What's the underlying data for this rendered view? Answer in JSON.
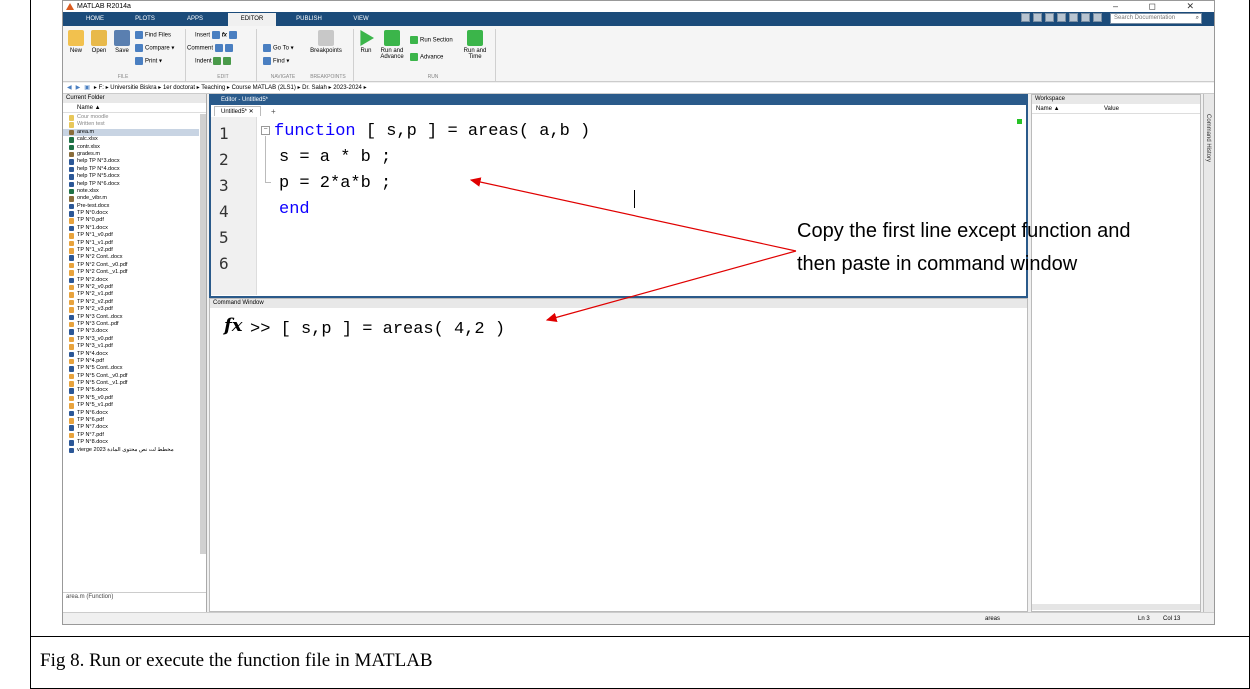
{
  "app": {
    "title": "MATLAB R2014a",
    "window_controls": "–  ◻  ✕"
  },
  "tabs": [
    "HOME",
    "PLOTS",
    "APPS",
    "EDITOR",
    "PUBLISH",
    "VIEW"
  ],
  "search_placeholder": "Search Documentation",
  "ribbon": {
    "file": {
      "new": "New",
      "open": "Open",
      "save": "Save",
      "find_files": "Find Files",
      "compare": "Compare ▾",
      "print": "Print ▾",
      "group": "FILE"
    },
    "edit": {
      "insert": "Insert",
      "comment": "Comment",
      "indent": "Indent",
      "group": "EDIT"
    },
    "navigate": {
      "goto": "Go To ▾",
      "find": "Find ▾",
      "group": "NAVIGATE"
    },
    "breakpoints": {
      "label": "Breakpoints",
      "group": "BREAKPOINTS"
    },
    "run": {
      "run": "Run",
      "run_advance": "Run and Advance",
      "run_section": "Run Section",
      "advance": "Advance",
      "run_time": "Run and Time",
      "group": "RUN"
    }
  },
  "address": "▸ F: ▸ Universitie Biskra ▸ 1er doctorat ▸ Teaching ▸ Course MATLAB (2LS1) ▸ Dr. Salah ▸ 2023-2024 ▸",
  "current_folder": {
    "title": "Current Folder",
    "column": "Name ▲",
    "files": [
      {
        "name": "Cour moodle",
        "type": "folder"
      },
      {
        "name": "Written test",
        "type": "folder"
      },
      {
        "name": "area.m",
        "type": "m",
        "selected": true
      },
      {
        "name": "calc.xlsx",
        "type": "xls"
      },
      {
        "name": "contr.xlsx",
        "type": "xls"
      },
      {
        "name": "grades.m",
        "type": "m"
      },
      {
        "name": "help TP N°3.docx",
        "type": "doc"
      },
      {
        "name": "help TP N°4.docx",
        "type": "doc"
      },
      {
        "name": "help TP N°5.docx",
        "type": "doc"
      },
      {
        "name": "help TP N°6.docx",
        "type": "doc"
      },
      {
        "name": "note.xlsx",
        "type": "xls"
      },
      {
        "name": "onde_vibr.m",
        "type": "m"
      },
      {
        "name": "Pre-test.docx",
        "type": "doc"
      },
      {
        "name": "TP N°0.docx",
        "type": "doc"
      },
      {
        "name": "TP N°0.pdf",
        "type": "pdf"
      },
      {
        "name": "TP N°1.docx",
        "type": "doc"
      },
      {
        "name": "TP N°1_v0.pdf",
        "type": "pdf"
      },
      {
        "name": "TP N°1_v1.pdf",
        "type": "pdf"
      },
      {
        "name": "TP N°1_v2.pdf",
        "type": "pdf"
      },
      {
        "name": "TP N°2 Cont..docx",
        "type": "doc"
      },
      {
        "name": "TP N°2 Cont._v0.pdf",
        "type": "pdf"
      },
      {
        "name": "TP N°2 Cont._v1.pdf",
        "type": "pdf"
      },
      {
        "name": "TP N°2.docx",
        "type": "doc"
      },
      {
        "name": "TP N°2_v0.pdf",
        "type": "pdf"
      },
      {
        "name": "TP N°2_v1.pdf",
        "type": "pdf"
      },
      {
        "name": "TP N°2_v2.pdf",
        "type": "pdf"
      },
      {
        "name": "TP N°2_v3.pdf",
        "type": "pdf"
      },
      {
        "name": "TP N°3 Cont..docx",
        "type": "doc"
      },
      {
        "name": "TP N°3 Cont..pdf",
        "type": "pdf"
      },
      {
        "name": "TP N°3.docx",
        "type": "doc"
      },
      {
        "name": "TP N°3_v0.pdf",
        "type": "pdf"
      },
      {
        "name": "TP N°3_v1.pdf",
        "type": "pdf"
      },
      {
        "name": "TP N°4.docx",
        "type": "doc"
      },
      {
        "name": "TP N°4.pdf",
        "type": "pdf"
      },
      {
        "name": "TP N°5 Cont..docx",
        "type": "doc"
      },
      {
        "name": "TP N°5 Cont._v0.pdf",
        "type": "pdf"
      },
      {
        "name": "TP N°5 Cont._v1.pdf",
        "type": "pdf"
      },
      {
        "name": "TP N°5.docx",
        "type": "doc"
      },
      {
        "name": "TP N°5_v0.pdf",
        "type": "pdf"
      },
      {
        "name": "TP N°5_v1.pdf",
        "type": "pdf"
      },
      {
        "name": "TP N°6.docx",
        "type": "doc"
      },
      {
        "name": "TP N°6.pdf",
        "type": "pdf"
      },
      {
        "name": "TP N°7.docx",
        "type": "doc"
      },
      {
        "name": "TP N°7.pdf",
        "type": "pdf"
      },
      {
        "name": "TP N°8.docx",
        "type": "doc"
      },
      {
        "name": "vierge 2023 مخطط لت نص محتوى المادة",
        "type": "doc"
      }
    ],
    "detail": "area.m (Function)"
  },
  "editor": {
    "title": "Editor - Untitled5*",
    "tab": "Untitled5*  ✕",
    "lines": [
      "1",
      "2",
      "3",
      "4",
      "5",
      "6"
    ],
    "code": {
      "kw1": "function",
      "l1": " [ s,p ] = areas( a,b )",
      "l2": "s = a * b ;",
      "l3": "p = 2*a*b ;",
      "kw4": "end"
    }
  },
  "command_window": {
    "title": "Command Window",
    "prompt": ">> [ s,p ] = areas( 4,2 )"
  },
  "workspace": {
    "title": "Workspace",
    "col_name": "Name ▲",
    "col_value": "Value"
  },
  "command_history": "Command History",
  "status": {
    "function": "areas",
    "ln": "Ln  3",
    "col": "Col  13"
  },
  "annotation": "Copy the first line except function and then paste in command window",
  "caption": "Fig 8. Run or execute the function file in MATLAB",
  "colors": {
    "tabbar": "#1b4b7a",
    "keyword": "#0e00ff",
    "arrow": "#e00000",
    "doc": "#2b5797",
    "pdf": "#e8a33d",
    "xls": "#1e7145",
    "m": "#8a6d3b"
  }
}
